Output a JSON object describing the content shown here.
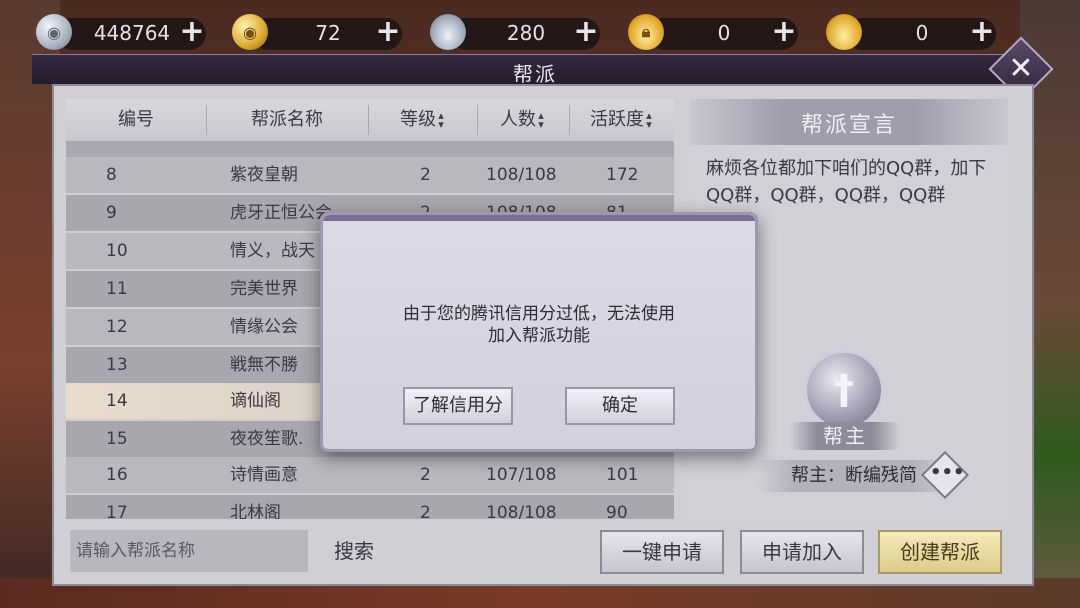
{
  "resources": [
    {
      "icon": "silver-coin-icon",
      "value": "448764"
    },
    {
      "icon": "gold-coin-icon",
      "value": "72"
    },
    {
      "icon": "silver-ingot-icon",
      "value": "280"
    },
    {
      "icon": "gold-ingot-bound-icon",
      "value": "0"
    },
    {
      "icon": "gold-ingot-icon",
      "value": "0"
    }
  ],
  "window": {
    "title": "帮派"
  },
  "table": {
    "headers": [
      "编号",
      "帮派名称",
      "等级",
      "人数",
      "活跃度"
    ],
    "rows": [
      {
        "id": "8",
        "name": "紫夜皇朝",
        "level": "2",
        "members": "108/108",
        "activity": "172"
      },
      {
        "id": "9",
        "name": "虎牙正恒公会",
        "level": "2",
        "members": "108/108",
        "activity": "81"
      },
      {
        "id": "10",
        "name": "情义，战天",
        "level": "",
        "members": "",
        "activity": ""
      },
      {
        "id": "11",
        "name": "完美世界",
        "level": "",
        "members": "",
        "activity": ""
      },
      {
        "id": "12",
        "name": "情缘公会",
        "level": "",
        "members": "",
        "activity": ""
      },
      {
        "id": "13",
        "name": "戦無不勝",
        "level": "",
        "members": "",
        "activity": ""
      },
      {
        "id": "14",
        "name": "谪仙阁",
        "level": "",
        "members": "",
        "activity": ""
      },
      {
        "id": "15",
        "name": "夜夜笙歌.",
        "level": "",
        "members": "",
        "activity": ""
      },
      {
        "id": "16",
        "name": "诗情画意",
        "level": "2",
        "members": "107/108",
        "activity": "101"
      },
      {
        "id": "17",
        "name": "北林阁",
        "level": "2",
        "members": "108/108",
        "activity": "90"
      }
    ]
  },
  "manifesto": {
    "title": "帮派宣言",
    "text": "麻烦各位都加下咱们的QQ群，加下QQ群，QQ群，QQ群，QQ群"
  },
  "leader": {
    "badge": "帮主",
    "line": "帮主：断编残简"
  },
  "bottom": {
    "search_placeholder": "请输入帮派名称",
    "search_label": "搜索",
    "apply_all": "一键申请",
    "apply_join": "申请加入",
    "create": "创建帮派"
  },
  "modal": {
    "message_line1": "由于您的腾讯信用分过低，无法使用",
    "message_line2": "加入帮派功能",
    "learn_button": "了解信用分",
    "ok_button": "确定"
  }
}
